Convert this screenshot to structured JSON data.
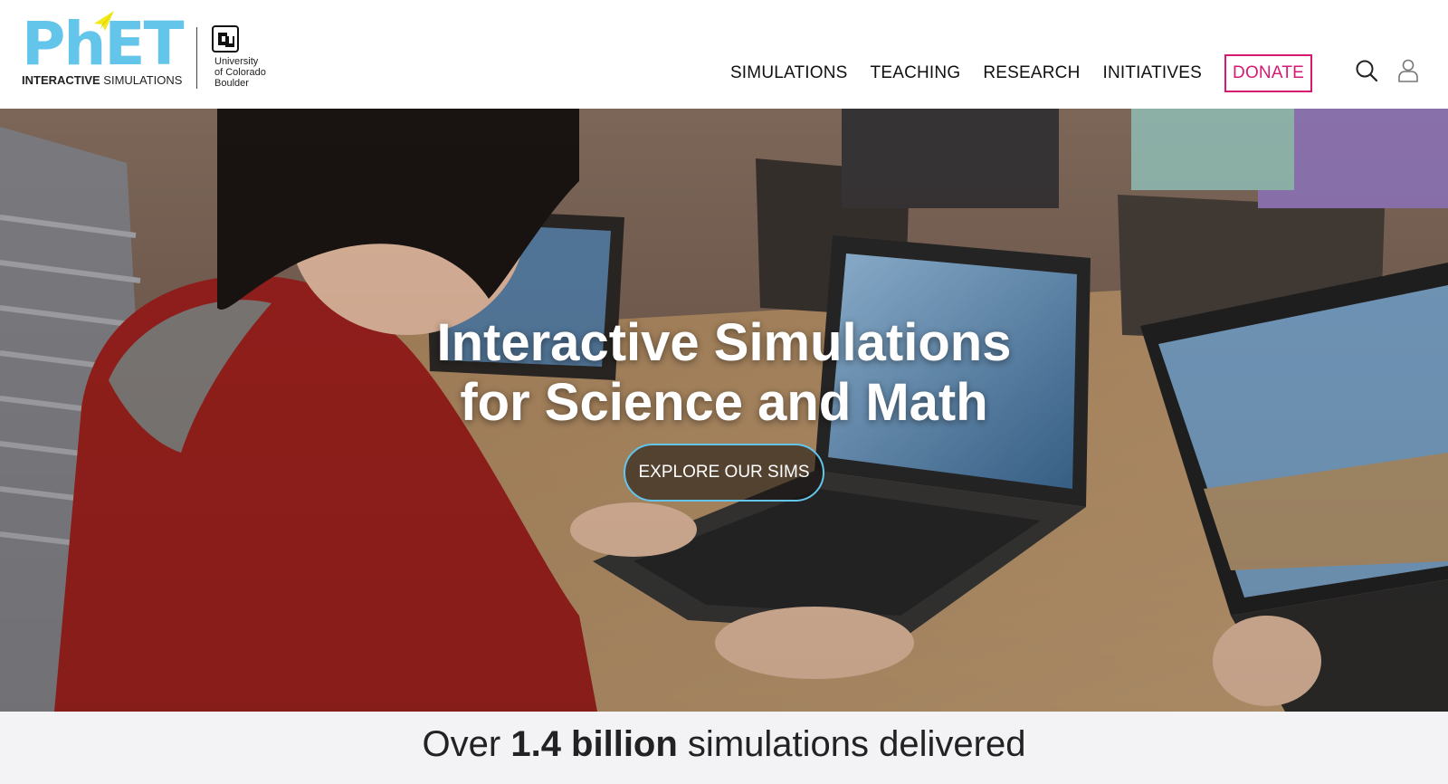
{
  "brand": {
    "logo_text": "PhET",
    "logo_sub_bold": "INTERACTIVE",
    "logo_sub_rest": " SIMULATIONS",
    "university_line1": "University",
    "university_line2": "of Colorado",
    "university_line3": "Boulder",
    "colors": {
      "phet_blue": "#63c5ea",
      "phet_yellow": "#f2e916",
      "donate_magenta": "#d61a73",
      "cta_border": "#63c5ea"
    }
  },
  "nav": {
    "items": [
      {
        "label": "SIMULATIONS"
      },
      {
        "label": "TEACHING"
      },
      {
        "label": "RESEARCH"
      },
      {
        "label": "INITIATIVES"
      }
    ],
    "donate_label": "DONATE",
    "search_icon": "search-icon",
    "account_icon": "user-icon"
  },
  "hero": {
    "title_line1": "Interactive Simulations",
    "title_line2": "for Science and Math",
    "cta_label": "EXPLORE OUR SIMS"
  },
  "stats": {
    "prefix": "Over ",
    "highlight": "1.4 billion",
    "suffix": " simulations delivered"
  }
}
